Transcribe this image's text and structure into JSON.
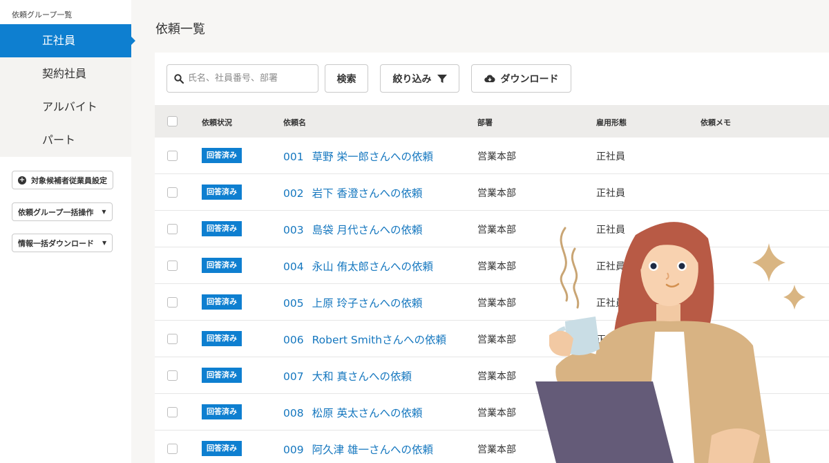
{
  "sidebar": {
    "group_label": "依頼グループ一覧",
    "items": [
      {
        "label": "正社員",
        "active": true
      },
      {
        "label": "契約社員",
        "active": false
      },
      {
        "label": "アルバイト",
        "active": false
      },
      {
        "label": "パート",
        "active": false
      }
    ],
    "buttons": {
      "target_settings": "対象候補者従業員設定",
      "bulk_group_ops": "依頼グループ一括操作",
      "bulk_info_download": "情報一括ダウンロード"
    }
  },
  "main": {
    "title": "依頼一覧",
    "search": {
      "placeholder": "氏名、社員番号、部署",
      "value": ""
    },
    "toolbar": {
      "search_label": "検索",
      "filter_label": "絞り込み",
      "download_label": "ダウンロード"
    },
    "table": {
      "headers": {
        "status": "依頼状況",
        "name": "依頼名",
        "dept": "部署",
        "employment": "雇用形態",
        "memo": "依頼メモ"
      },
      "rows": [
        {
          "status": "回答済み",
          "num": "001",
          "name": "草野 栄一郎さんへの依頼",
          "dept": "営業本部",
          "employment": "正社員"
        },
        {
          "status": "回答済み",
          "num": "002",
          "name": "岩下 香澄さんへの依頼",
          "dept": "営業本部",
          "employment": "正社員"
        },
        {
          "status": "回答済み",
          "num": "003",
          "name": "島袋 月代さんへの依頼",
          "dept": "営業本部",
          "employment": "正社員"
        },
        {
          "status": "回答済み",
          "num": "004",
          "name": "永山 侑太郎さんへの依頼",
          "dept": "営業本部",
          "employment": "正社員"
        },
        {
          "status": "回答済み",
          "num": "005",
          "name": "上原 玲子さんへの依頼",
          "dept": "営業本部",
          "employment": "正社員"
        },
        {
          "status": "回答済み",
          "num": "006",
          "name": "Robert Smithさんへの依頼",
          "dept": "営業本部",
          "employment": "正社員"
        },
        {
          "status": "回答済み",
          "num": "007",
          "name": "大和 真さんへの依頼",
          "dept": "営業本部",
          "employment": ""
        },
        {
          "status": "回答済み",
          "num": "008",
          "name": "松原 英太さんへの依頼",
          "dept": "営業本部",
          "employment": ""
        },
        {
          "status": "回答済み",
          "num": "009",
          "name": "阿久津 雄一さんへの依頼",
          "dept": "営業本部",
          "employment": ""
        }
      ]
    }
  },
  "colors": {
    "accent": "#0e7fd0",
    "link": "#1577bf",
    "header_bg": "#edecea"
  },
  "icons": [
    "search-icon",
    "filter-icon",
    "cloud-download-icon",
    "plus-circle-icon",
    "caret-down-icon"
  ]
}
